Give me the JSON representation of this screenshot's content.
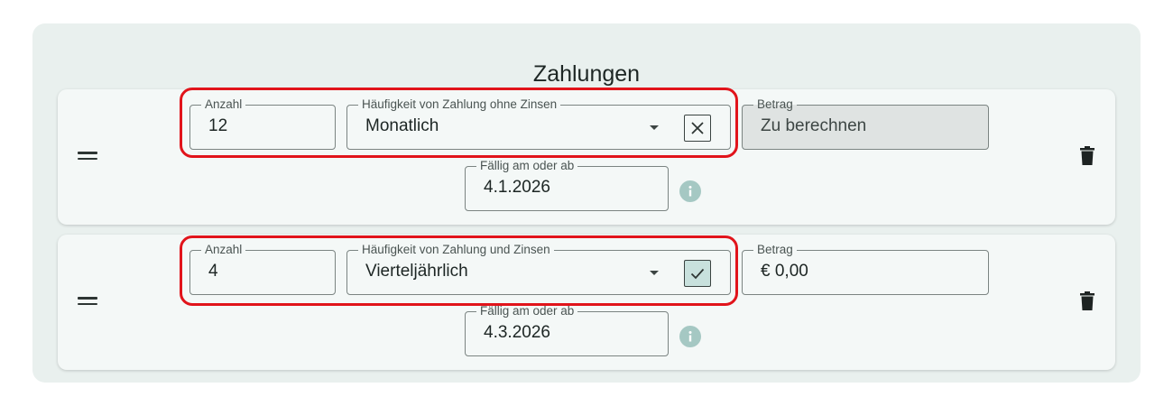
{
  "title": "Zahlungen",
  "payments": [
    {
      "anzahl_label": "Anzahl",
      "anzahl_value": "12",
      "frequency_label": "Häufigkeit von Zahlung ohne Zinsen",
      "frequency_value": "Monatlich",
      "interest_checked": false,
      "betrag_label": "Betrag",
      "betrag_value": "Zu berechnen",
      "faellig_label": "Fällig am oder ab",
      "faellig_value": "4.1.2026"
    },
    {
      "anzahl_label": "Anzahl",
      "anzahl_value": "4",
      "frequency_label": "Häufigkeit von Zahlung und Zinsen",
      "frequency_value": "Vierteljährlich",
      "interest_checked": true,
      "betrag_label": "Betrag",
      "betrag_value": "€ 0,00",
      "faellig_label": "Fällig am oder ab",
      "faellig_value": "4.3.2026"
    }
  ],
  "colors": {
    "panel_bg": "#e9f0ee",
    "card_bg": "#f4f8f7",
    "checkbox_checked_bg": "#c8e1dd",
    "info_icon": "#a5c8c3",
    "highlight": "#e1141b"
  },
  "icons": [
    "drag-handle-icon",
    "chevron-down-icon",
    "close-icon",
    "check-icon",
    "info-icon",
    "trash-icon"
  ]
}
